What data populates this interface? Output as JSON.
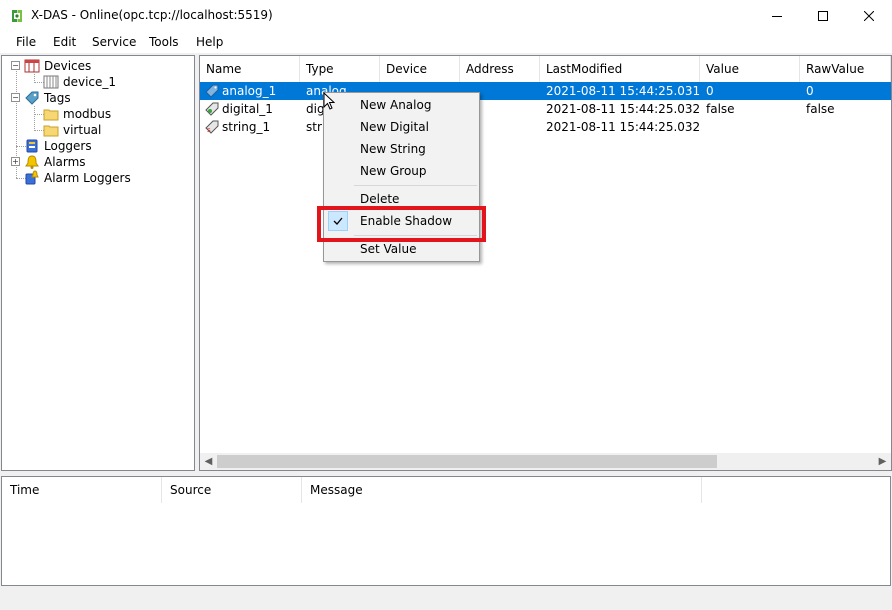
{
  "window": {
    "title": "X-DAS - Online(opc.tcp://localhost:5519)"
  },
  "menu": [
    "File",
    "Edit",
    "Service",
    "Tools",
    "Help"
  ],
  "tree": {
    "devices": "Devices",
    "device_1": "device_1",
    "tags": "Tags",
    "modbus": "modbus",
    "virtual": "virtual",
    "loggers": "Loggers",
    "alarms": "Alarms",
    "alarm_loggers": "Alarm Loggers"
  },
  "tag_table": {
    "columns": [
      "Name",
      "Type",
      "Device",
      "Address",
      "LastModified",
      "Value",
      "RawValue"
    ],
    "rows": [
      {
        "name": "analog_1",
        "type": "analog",
        "device": "",
        "address": "",
        "last_modified": "2021-08-11 15:44:25.031",
        "value": "0",
        "raw_value": "0",
        "selected": true
      },
      {
        "name": "digital_1",
        "type": "digi",
        "device": "",
        "address": "",
        "last_modified": "2021-08-11 15:44:25.032",
        "value": "false",
        "raw_value": "false",
        "selected": false
      },
      {
        "name": "string_1",
        "type": "stri",
        "device": "",
        "address": "",
        "last_modified": "2021-08-11 15:44:25.032",
        "value": "",
        "raw_value": "",
        "selected": false
      }
    ]
  },
  "events": {
    "columns": [
      "Time",
      "Source",
      "Message"
    ]
  },
  "context_menu": {
    "items": [
      "New Analog",
      "New Digital",
      "New String",
      "New Group",
      "Delete",
      "Enable Shadow",
      "Set Value"
    ],
    "checked": "Enable Shadow"
  },
  "colors": {
    "selection": "#0078d7",
    "highlight": "#e2141c"
  }
}
